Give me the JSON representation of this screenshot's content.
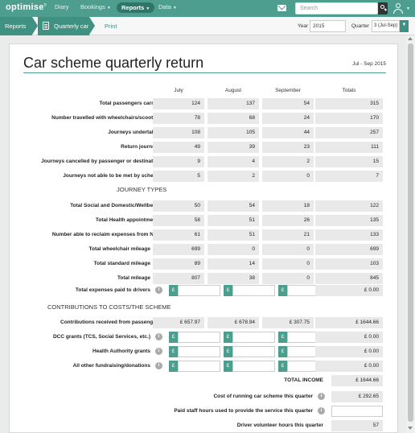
{
  "nav": {
    "logo": "optimise",
    "logo_sup": "tr",
    "diary": "Diary",
    "bookings": "Bookings",
    "reports": "Reports",
    "data": "Data",
    "search_placeholder": "Search"
  },
  "breadcrumb": {
    "reports": "Reports",
    "current": "Quarterly car",
    "print": "Print"
  },
  "filters": {
    "year_label": "Year",
    "year_value": "2015",
    "quarter_label": "Quarter",
    "quarter_value": "3 (Jul-Sep)"
  },
  "report": {
    "title": "Car scheme quarterly return",
    "date_range": "Jul - Sep 2015",
    "columns": [
      "July",
      "August",
      "September",
      "Totals"
    ],
    "rows_top": [
      {
        "label": "Total passengers carried",
        "values": [
          "124",
          "137",
          "54",
          "315"
        ]
      },
      {
        "label": "Number travelled with wheelchairs/scooters",
        "values": [
          "78",
          "68",
          "24",
          "170"
        ]
      },
      {
        "label": "Journeys undertaken",
        "values": [
          "108",
          "105",
          "44",
          "257"
        ]
      },
      {
        "label": "Return journeys",
        "values": [
          "49",
          "39",
          "23",
          "111"
        ]
      },
      {
        "label": "Journeys cancelled by passenger or destination",
        "values": [
          "9",
          "4",
          "2",
          "15"
        ]
      },
      {
        "label": "Journeys not able to be met by scheme",
        "values": [
          "5",
          "2",
          "0",
          "7"
        ]
      }
    ],
    "section_journey_types": "JOURNEY TYPES",
    "rows_journey": [
      {
        "label": "Total Social and Domestic/Wellbeing",
        "values": [
          "50",
          "54",
          "18",
          "122"
        ]
      },
      {
        "label": "Total Health appointments",
        "values": [
          "58",
          "51",
          "26",
          "135"
        ]
      },
      {
        "label": "Number able to reclaim expenses from NHS",
        "values": [
          "61",
          "51",
          "21",
          "133"
        ]
      },
      {
        "label": "Total wheelchair mileage",
        "values": [
          "699",
          "0",
          "0",
          "699"
        ]
      },
      {
        "label": "Total standard mileage",
        "values": [
          "89",
          "14",
          "0",
          "103"
        ]
      },
      {
        "label": "Total mileage",
        "values": [
          "807",
          "38",
          "0",
          "845"
        ]
      }
    ],
    "expenses_label": "Total expenses paid to drivers",
    "expenses_total": "£ 0.00",
    "section_contributions": "CONTRIBUTIONS TO COSTS/THE SCHEME",
    "contributions_label": "Contributions received from passengers",
    "contributions_values": [
      "£ 657.97",
      "£ 678.94",
      "£ 307.75",
      "£ 1644.66"
    ],
    "grant_rows": [
      {
        "label": "DCC grants (TCS, Social Services, etc.)",
        "total": "£ 0.00"
      },
      {
        "label": "Health Authority grants",
        "total": "£ 0.00"
      },
      {
        "label": "All other fundraising/donations",
        "total": "£ 0.00"
      }
    ],
    "pound_symbol": "£",
    "total_income_label": "TOTAL INCOME",
    "total_income_value": "£ 1644.66",
    "running_cost_label": "Cost of running car scheme this quarter",
    "running_cost_value": "£ 292.65",
    "staff_hours_label": "Paid staff hours used to provide the service this quarter",
    "volunteer_hours_label": "Driver volunteer hours this quarter",
    "volunteer_hours_value": "57",
    "info_glyph": "i"
  },
  "icons": [
    "mail-icon",
    "search-icon",
    "user-icon",
    "document-icon",
    "info-icon"
  ],
  "colors": {
    "accent": "#4d9e8f",
    "accent_dark": "#2f7668"
  }
}
